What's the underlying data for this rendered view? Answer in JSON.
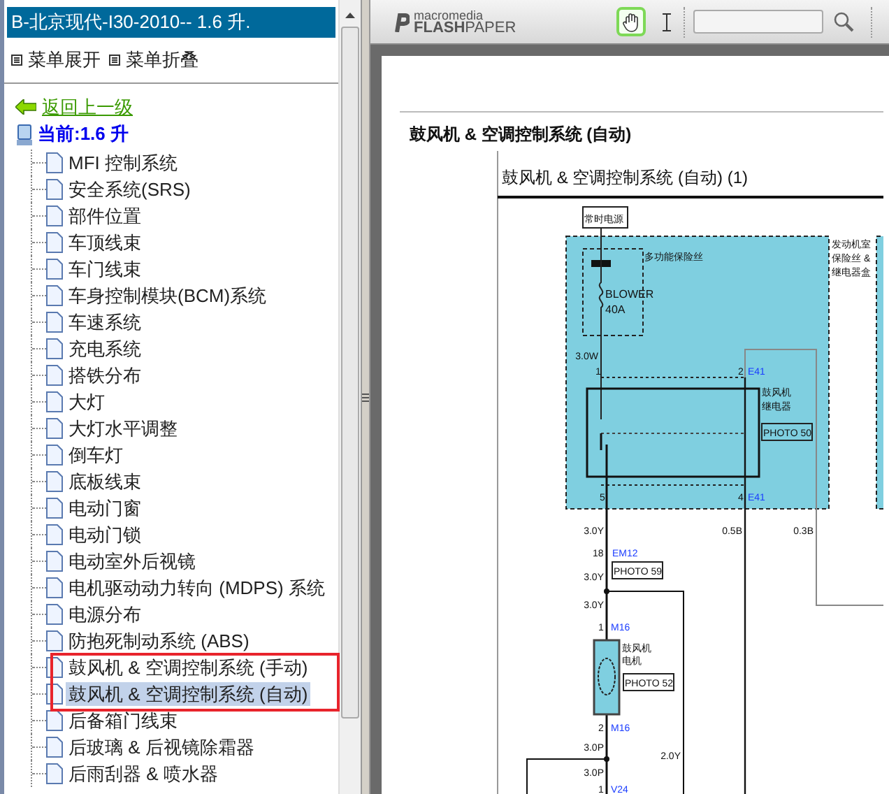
{
  "sidebar": {
    "title": "B-北京现代-I30-2010-- 1.6 升.",
    "actions": [
      {
        "label": "菜单展开"
      },
      {
        "label": "菜单折叠"
      }
    ],
    "back_link": "返回上一级",
    "current": "当前:1.6 升",
    "items": [
      {
        "label": "MFI 控制系统",
        "selected": false,
        "boxed": false
      },
      {
        "label": "安全系统(SRS)",
        "selected": false,
        "boxed": false
      },
      {
        "label": "部件位置",
        "selected": false,
        "boxed": false
      },
      {
        "label": "车顶线束",
        "selected": false,
        "boxed": false
      },
      {
        "label": "车门线束",
        "selected": false,
        "boxed": false
      },
      {
        "label": "车身控制模块(BCM)系统",
        "selected": false,
        "boxed": false
      },
      {
        "label": "车速系统",
        "selected": false,
        "boxed": false
      },
      {
        "label": "充电系统",
        "selected": false,
        "boxed": false
      },
      {
        "label": "搭铁分布",
        "selected": false,
        "boxed": false
      },
      {
        "label": "大灯",
        "selected": false,
        "boxed": false
      },
      {
        "label": "大灯水平调整",
        "selected": false,
        "boxed": false
      },
      {
        "label": "倒车灯",
        "selected": false,
        "boxed": false
      },
      {
        "label": "底板线束",
        "selected": false,
        "boxed": false
      },
      {
        "label": "电动门窗",
        "selected": false,
        "boxed": false
      },
      {
        "label": "电动门锁",
        "selected": false,
        "boxed": false
      },
      {
        "label": "电动室外后视镜",
        "selected": false,
        "boxed": false
      },
      {
        "label": "电机驱动动力转向 (MDPS) 系统",
        "selected": false,
        "boxed": false
      },
      {
        "label": "电源分布",
        "selected": false,
        "boxed": false
      },
      {
        "label": "防抱死制动系统 (ABS)",
        "selected": false,
        "boxed": false
      },
      {
        "label": "鼓风机 & 空调控制系统 (手动)",
        "selected": false,
        "boxed": true
      },
      {
        "label": "鼓风机 & 空调控制系统 (自动)",
        "selected": true,
        "boxed": true
      },
      {
        "label": "后备箱门线束",
        "selected": false,
        "boxed": false
      },
      {
        "label": "后玻璃 & 后视镜除霜器",
        "selected": false,
        "boxed": false
      },
      {
        "label": "后雨刮器 & 喷水器",
        "selected": false,
        "boxed": false
      }
    ]
  },
  "viewer": {
    "logo_top": "macromedia",
    "logo_bold": "FLASH",
    "logo_light": "PAPER",
    "hand_tool_selected": true,
    "page_heading": "鼓风机  &  空调控制系统 (自动)",
    "diagram": {
      "title": "鼓风机 & 空调控制系统 (自动) (1)",
      "source": "常时电源",
      "fuse_box_label": "多功能保险丝",
      "fuse_name": "BLOWER",
      "fuse_rating": "40A",
      "panel_label": [
        "发动机室",
        "保险丝 &",
        "继电器盒"
      ],
      "wire_1": "3.0W",
      "pin_1": "1",
      "pin_2": "2",
      "conn_top": "E41",
      "relay_label": [
        "鼓风机",
        "继电器"
      ],
      "relay_photo": "PHOTO 50",
      "pin_5": "5",
      "pin_4": "4",
      "conn_bottom": "E41",
      "wire_a": "3.0Y",
      "wire_b": "0.5B",
      "wire_c": "0.3B",
      "pin_18": "18",
      "conn_em": "EM12",
      "photo_59": "PHOTO 59",
      "wire_d": "3.0Y",
      "wire_e": "3.0Y",
      "motor_pin_1": "1",
      "motor_conn_1": "M16",
      "motor_label": [
        "鼓风机",
        "电机"
      ],
      "motor_photo": "PHOTO 52",
      "motor_pin_2": "2",
      "motor_conn_2": "M16",
      "wire_f": "3.0P",
      "wire_g": "3.0P",
      "wire_h": "2.0Y",
      "pin_v": "1",
      "conn_v": "V24"
    }
  }
}
